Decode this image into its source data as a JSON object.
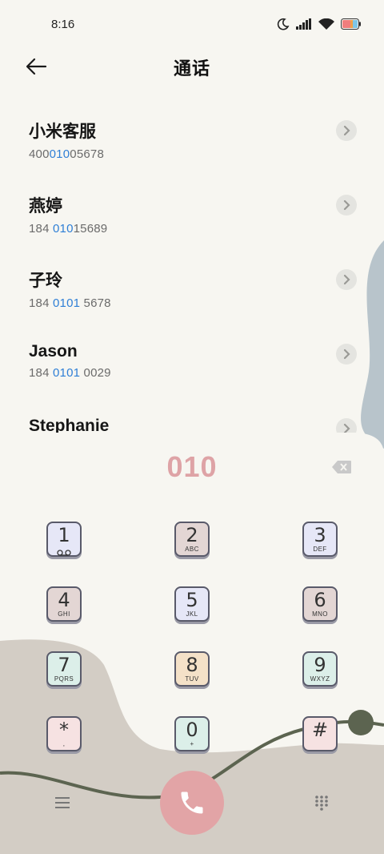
{
  "status_bar": {
    "time": "8:16",
    "icons": [
      "moon-icon",
      "signal-icon",
      "wifi-icon",
      "battery-icon"
    ]
  },
  "header": {
    "title": "通话"
  },
  "contacts": [
    {
      "name": "小米客服",
      "num_before": "400",
      "num_match": "010",
      "num_after": "05678"
    },
    {
      "name": "燕婷",
      "num_before": "184 ",
      "num_match": "010",
      "num_after": "15689"
    },
    {
      "name": "子玲",
      "num_before": "184 ",
      "num_match": "0101",
      "num_after": " 5678"
    },
    {
      "name": "Jason",
      "num_before": "184 ",
      "num_match": "0101",
      "num_after": " 0029"
    },
    {
      "name": "Stephanie",
      "num_before": "",
      "num_match": "",
      "num_after": ""
    }
  ],
  "dialer": {
    "typed_number": "010",
    "keys": [
      {
        "digit": "1",
        "letters": "",
        "color": "#e6e7f7"
      },
      {
        "digit": "2",
        "letters": "ABC",
        "color": "#e3d6d4"
      },
      {
        "digit": "3",
        "letters": "DEF",
        "color": "#e6e7f7"
      },
      {
        "digit": "4",
        "letters": "GHI",
        "color": "#e3d6d4"
      },
      {
        "digit": "5",
        "letters": "JKL",
        "color": "#e6e7f7"
      },
      {
        "digit": "6",
        "letters": "MNO",
        "color": "#e3d6d4"
      },
      {
        "digit": "7",
        "letters": "PQRS",
        "color": "#dcefe9"
      },
      {
        "digit": "8",
        "letters": "TUV",
        "color": "#f4e1c8"
      },
      {
        "digit": "9",
        "letters": "WXYZ",
        "color": "#dcefe9"
      },
      {
        "digit": "*",
        "letters": ",",
        "color": "#f6e2e2"
      },
      {
        "digit": "0",
        "letters": "+",
        "color": "#dcefe9"
      },
      {
        "digit": "#",
        "letters": "",
        "color": "#f6e2e2"
      }
    ]
  },
  "colors": {
    "background": "#f7f6f1",
    "accent_match": "#2f7fd6",
    "typed_number": "#dea3a6",
    "call_button": "#e2a4a6",
    "wave_taupe": "#d3cdc5",
    "blue_grey_shape": "#b8c4cb",
    "line_dark": "#5c6450"
  }
}
